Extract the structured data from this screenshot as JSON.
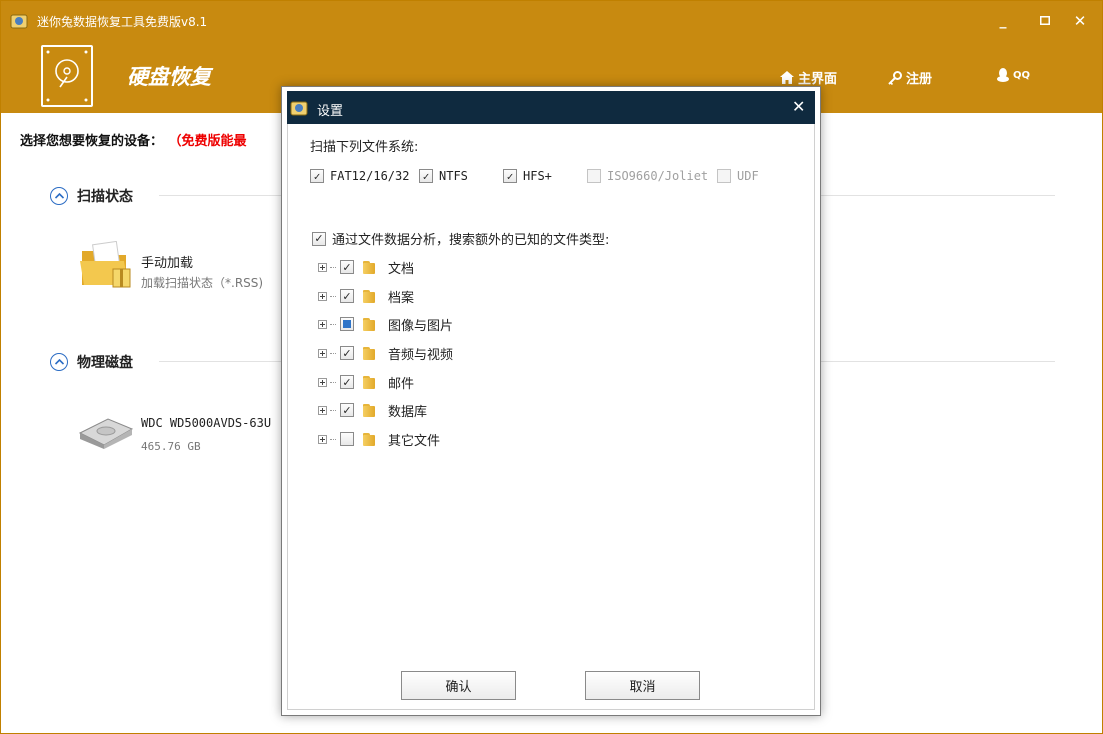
{
  "app": {
    "title": "迷你兔数据恢复工具免费版v8.1"
  },
  "header": {
    "module_title": "硬盘恢复",
    "nav": [
      {
        "label": "主界面",
        "icon": "home-icon"
      },
      {
        "label": "注册",
        "icon": "key-icon"
      },
      {
        "label": "QQ",
        "icon": "qq-penguin-icon"
      }
    ]
  },
  "main": {
    "device_prompt": "选择您想要恢复的设备：",
    "warning": "（免费版能最",
    "sections": [
      {
        "title": "扫描状态",
        "items": [
          {
            "title": "手动加载",
            "subtitle": "加载扫描状态（*.RSS)"
          }
        ]
      },
      {
        "title": "物理磁盘",
        "items": [
          {
            "title": "WDC WD5000AVDS-63U",
            "subtitle": "465.76 GB"
          }
        ]
      }
    ]
  },
  "dialog": {
    "title": "设置",
    "fs_label": "扫描下列文件系统:",
    "fs_options": [
      {
        "label": "FAT12/16/32",
        "checked": true,
        "enabled": true
      },
      {
        "label": "NTFS",
        "checked": true,
        "enabled": true
      },
      {
        "label": "HFS+",
        "checked": true,
        "enabled": true
      },
      {
        "label": "ISO9660/Joliet",
        "checked": false,
        "enabled": false
      },
      {
        "label": "UDF",
        "checked": false,
        "enabled": false
      }
    ],
    "analysis_label": "通过文件数据分析，搜索额外的已知的文件类型:",
    "analysis_checked": true,
    "file_types": [
      {
        "label": "文档",
        "state": "checked"
      },
      {
        "label": "档案",
        "state": "checked"
      },
      {
        "label": "图像与图片",
        "state": "partial"
      },
      {
        "label": "音频与视频",
        "state": "checked"
      },
      {
        "label": "邮件",
        "state": "checked"
      },
      {
        "label": "数据库",
        "state": "checked"
      },
      {
        "label": "其它文件",
        "state": "unchecked"
      }
    ],
    "ok_label": "确认",
    "cancel_label": "取消"
  },
  "colors": {
    "accent": "#c88a10",
    "dialog_titlebar": "#0f2a3f",
    "warning": "#e00000",
    "link_blue": "#2b6cc4"
  }
}
